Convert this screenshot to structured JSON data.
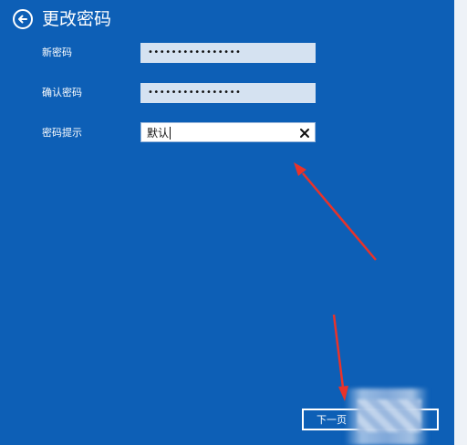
{
  "header": {
    "title": "更改密码",
    "back_icon": "back-arrow-icon"
  },
  "form": {
    "new_password": {
      "label": "新密码",
      "masked_value": "••••••••••••••••"
    },
    "confirm_password": {
      "label": "确认密码",
      "masked_value": "••••••••••••••••"
    },
    "password_hint": {
      "label": "密码提示",
      "value": "默认",
      "clear_icon": "close-icon"
    }
  },
  "footer": {
    "next_label": "下一页"
  },
  "colors": {
    "background": "#0d5fb6",
    "annotation_arrow": "#e8332a"
  }
}
